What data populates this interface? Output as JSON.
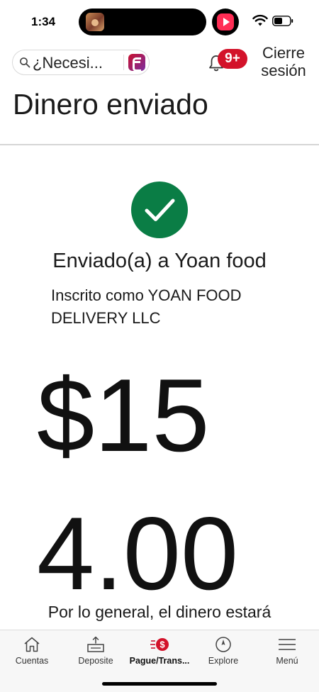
{
  "status_bar": {
    "time": "1:34"
  },
  "header": {
    "search_placeholder": "¿Necesi...",
    "notification_count": "9+",
    "signout_label": "Cierre sesión"
  },
  "page": {
    "title": "Dinero enviado"
  },
  "confirmation": {
    "sent_to": "Enviado(a) a Yoan food",
    "registered_as": "Inscrito como YOAN FOOD DELIVERY LLC",
    "amount": "$154.00",
    "note": "Por lo general, el dinero estará"
  },
  "tab_bar": {
    "tabs": [
      {
        "label": "Cuentas",
        "icon": "home-icon"
      },
      {
        "label": "Deposite",
        "icon": "deposit-icon"
      },
      {
        "label": "Pague/Trans...",
        "icon": "pay-transfer-icon"
      },
      {
        "label": "Explore",
        "icon": "compass-icon"
      },
      {
        "label": "Menú",
        "icon": "menu-icon"
      }
    ],
    "active_index": 2
  },
  "colors": {
    "success_green": "#0a7d45",
    "badge_red": "#d3122a",
    "brand_red": "#c8102e"
  }
}
